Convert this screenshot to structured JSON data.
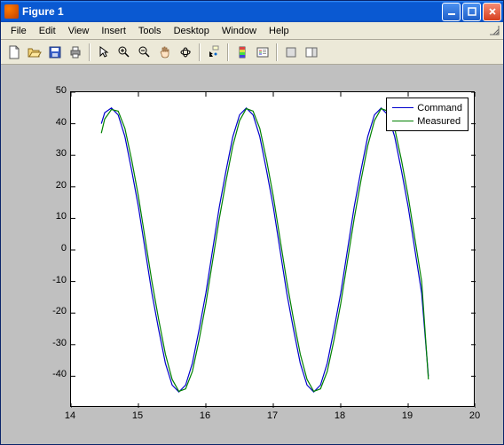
{
  "window": {
    "title": "Figure 1"
  },
  "menu": {
    "file": "File",
    "edit": "Edit",
    "view": "View",
    "insert": "Insert",
    "tools": "Tools",
    "desktop": "Desktop",
    "window_": "Window",
    "help": "Help"
  },
  "toolbar": {
    "new": "new",
    "open": "open",
    "save": "save",
    "print": "print",
    "pointer": "pointer",
    "zoom_in": "zoom-in",
    "zoom_out": "zoom-out",
    "pan": "pan",
    "rotate": "rotate",
    "data_cursor": "data-cursor",
    "insert_colorbar": "colorbar",
    "insert_legend": "legend",
    "hide_tools": "hide-tools",
    "show_tools": "show-tools"
  },
  "legend": {
    "command": "Command",
    "measured": "Measured"
  },
  "colors": {
    "command": "#0000cc",
    "measured": "#008000",
    "axes_bg": "#ffffff",
    "figure_bg": "#c0c0c0"
  },
  "chart_data": {
    "type": "line",
    "xlabel": "",
    "ylabel": "",
    "title": "",
    "xlim": [
      14,
      20
    ],
    "ylim": [
      -50,
      50
    ],
    "xticks": [
      14,
      15,
      16,
      17,
      18,
      19,
      20
    ],
    "yticks": [
      -40,
      -30,
      -20,
      -10,
      0,
      10,
      20,
      30,
      40,
      50
    ],
    "series": [
      {
        "name": "Command",
        "color": "#0000cc",
        "x": [
          14.45,
          14.5,
          14.6,
          14.7,
          14.8,
          14.9,
          15.0,
          15.1,
          15.2,
          15.3,
          15.4,
          15.5,
          15.6,
          15.7,
          15.8,
          15.9,
          16.0,
          16.1,
          16.2,
          16.3,
          16.4,
          16.5,
          16.6,
          16.7,
          16.8,
          16.9,
          17.0,
          17.1,
          17.2,
          17.3,
          17.4,
          17.5,
          17.6,
          17.7,
          17.8,
          17.9,
          18.0,
          18.1,
          18.2,
          18.3,
          18.4,
          18.5,
          18.6,
          18.7,
          18.8,
          18.9,
          19.0,
          19.1,
          19.2,
          19.3
        ],
        "y": [
          40.0,
          43.5,
          45.0,
          42.8,
          35.9,
          25.2,
          13.7,
          0.0,
          -13.7,
          -25.2,
          -35.9,
          -42.8,
          -45.0,
          -42.8,
          -35.9,
          -25.2,
          -13.7,
          0.0,
          13.7,
          25.2,
          35.9,
          42.8,
          45.0,
          42.8,
          35.9,
          25.2,
          13.7,
          0.0,
          -13.7,
          -25.2,
          -35.9,
          -42.8,
          -45.0,
          -42.8,
          -35.9,
          -25.2,
          -13.7,
          0.0,
          13.7,
          25.2,
          35.9,
          42.8,
          45.0,
          42.8,
          35.9,
          25.2,
          13.7,
          0.0,
          -13.7,
          -40.0
        ]
      },
      {
        "name": "Measured",
        "color": "#008000",
        "x": [
          14.45,
          14.5,
          14.6,
          14.7,
          14.8,
          14.9,
          15.0,
          15.1,
          15.2,
          15.3,
          15.4,
          15.5,
          15.6,
          15.7,
          15.8,
          15.9,
          16.0,
          16.1,
          16.2,
          16.3,
          16.4,
          16.5,
          16.6,
          16.7,
          16.8,
          16.9,
          17.0,
          17.1,
          17.2,
          17.3,
          17.4,
          17.5,
          17.6,
          17.7,
          17.8,
          17.9,
          18.0,
          18.1,
          18.2,
          18.3,
          18.4,
          18.5,
          18.6,
          18.7,
          18.8,
          18.9,
          19.0,
          19.1,
          19.2,
          19.3
        ],
        "y": [
          37.0,
          41.5,
          44.5,
          44.0,
          38.5,
          28.5,
          17.0,
          3.5,
          -10.0,
          -22.0,
          -33.0,
          -41.0,
          -44.8,
          -44.0,
          -38.5,
          -28.5,
          -17.0,
          -3.5,
          10.0,
          22.0,
          33.0,
          41.0,
          44.8,
          44.0,
          38.5,
          28.5,
          17.0,
          3.5,
          -10.0,
          -22.0,
          -33.0,
          -41.0,
          -44.8,
          -44.0,
          -38.5,
          -28.5,
          -17.0,
          -3.5,
          10.0,
          22.0,
          33.0,
          41.0,
          44.8,
          44.0,
          38.5,
          28.5,
          17.0,
          3.5,
          -10.0,
          -41.0
        ]
      }
    ]
  }
}
